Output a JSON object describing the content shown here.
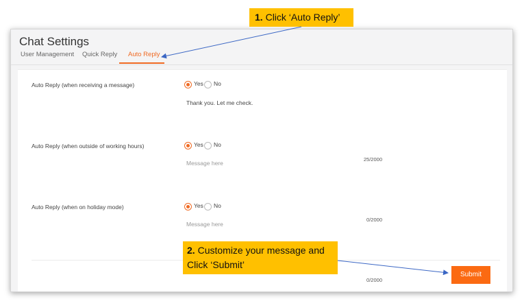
{
  "window": {
    "title": "Chat Settings",
    "tabs": [
      {
        "label": "User Management",
        "active": false
      },
      {
        "label": "Quick Reply",
        "active": false
      },
      {
        "label": "Auto Reply",
        "active": true
      }
    ]
  },
  "settings": [
    {
      "label": "Auto Reply (when receiving a message)",
      "yes_label": "Yes",
      "no_label": "No",
      "selected": "Yes",
      "message": "Thank you. Let me check.",
      "placeholder": "Message here",
      "counter": "25/2000"
    },
    {
      "label": "Auto Reply (when outside of working hours)",
      "yes_label": "Yes",
      "no_label": "No",
      "selected": "Yes",
      "message": "",
      "placeholder": "Message here",
      "counter": "0/2000"
    },
    {
      "label": "Auto Reply (when on holiday mode)",
      "yes_label": "Yes",
      "no_label": "No",
      "selected": "Yes",
      "message": "",
      "placeholder": "Message here",
      "counter": "0/2000"
    }
  ],
  "submit_label": "Submit",
  "callouts": {
    "step1": {
      "number": "1.",
      "text": "Click ‘Auto Reply’"
    },
    "step2": {
      "number": "2.",
      "text": "Customize your message and Click ‘Submit’"
    }
  },
  "colors": {
    "accent": "#f06a23",
    "submit": "#fb6a12",
    "callout": "#ffc000",
    "arrow": "#3a66c4"
  }
}
